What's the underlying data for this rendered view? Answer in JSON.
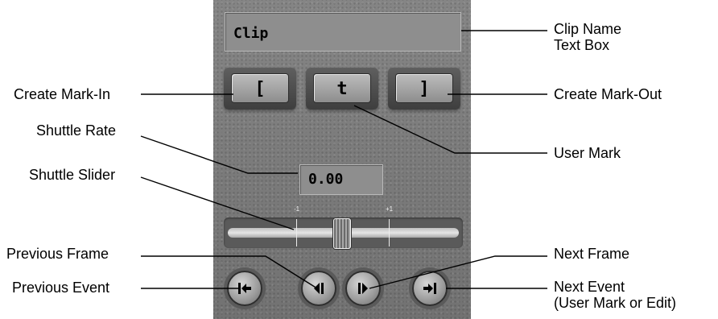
{
  "panel": {
    "clip_text": "Clip",
    "shuttle_rate": "0.00",
    "mark_buttons": [
      {
        "name": "create-mark-in-button",
        "glyph": "["
      },
      {
        "name": "user-mark-button",
        "glyph": "t"
      },
      {
        "name": "create-mark-out-button",
        "glyph": "]"
      }
    ],
    "slider": {
      "min_label": "-1",
      "max_label": "+1",
      "position": 0.0
    },
    "nav_icons": [
      "previous-event-icon",
      "previous-frame-icon",
      "next-frame-icon",
      "next-event-icon"
    ]
  },
  "callouts": {
    "clip_name_line1": "Clip Name",
    "clip_name_line2": "Text Box",
    "create_mark_in": "Create Mark-In",
    "create_mark_out": "Create Mark-Out",
    "shuttle_rate": "Shuttle Rate",
    "user_mark": "User Mark",
    "shuttle_slider": "Shuttle Slider",
    "previous_frame": "Previous Frame",
    "next_frame": "Next Frame",
    "previous_event": "Previous Event",
    "next_event_line1": "Next Event",
    "next_event_line2": "(User Mark or Edit)"
  }
}
